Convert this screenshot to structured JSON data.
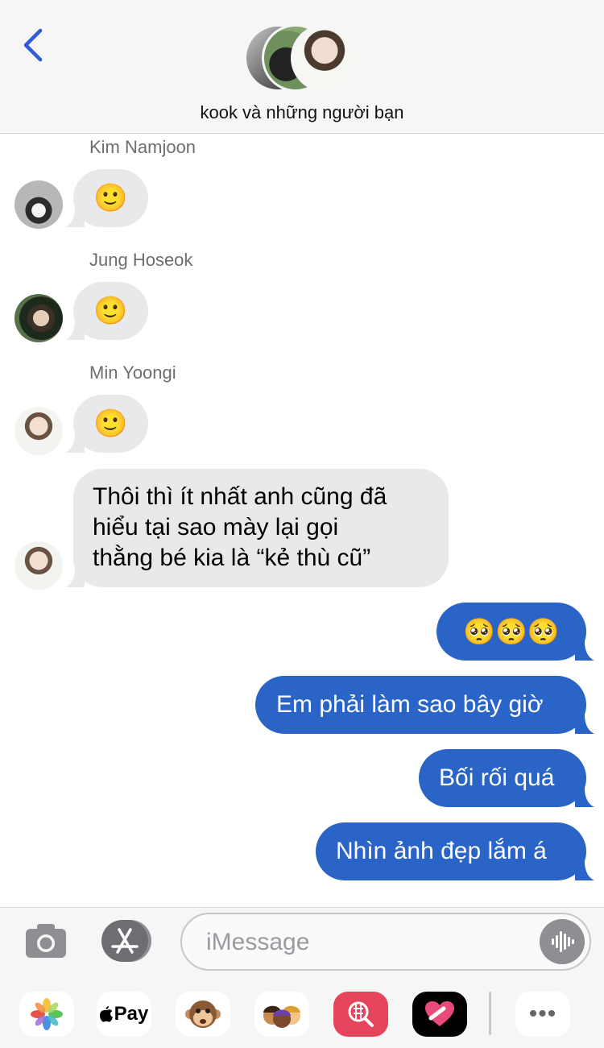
{
  "header": {
    "title": "kook và những người bạn"
  },
  "messages": {
    "m1": {
      "sender": "Kim Namjoon",
      "text": "🙂"
    },
    "m2": {
      "sender": "Jung Hoseok",
      "text": "🙂"
    },
    "m3": {
      "sender": "Min Yoongi",
      "text": "🙂"
    },
    "m4": {
      "line1": "Thôi thì ít nhất anh cũng đã",
      "line2": "hiểu tại sao mày lại gọi",
      "line3": "thằng bé kia là “kẻ thù cũ”"
    },
    "m5": {
      "text": "🥺🥺🥺"
    },
    "m6": {
      "text": "Em phải làm sao bây giờ"
    },
    "m7": {
      "text": "Bối rối quá"
    },
    "m8": {
      "text": "Nhìn ảnh đẹp lắm á"
    }
  },
  "composer": {
    "placeholder": "iMessage"
  },
  "apps": {
    "apple_pay_label": "Pay",
    "more_label": "•••"
  },
  "colors": {
    "outgoing_bubble": "#2a64c7",
    "incoming_bubble": "#e9e9eb",
    "accent": "#2f5bd6"
  },
  "icons": [
    "back-chevron-icon",
    "camera-icon",
    "app-store-icon",
    "audio-waveform-icon",
    "photos-app-icon",
    "apple-pay-icon",
    "memoji-monkey-icon",
    "memoji-stickers-icon",
    "search-images-icon",
    "digital-touch-icon",
    "more-apps-icon"
  ]
}
